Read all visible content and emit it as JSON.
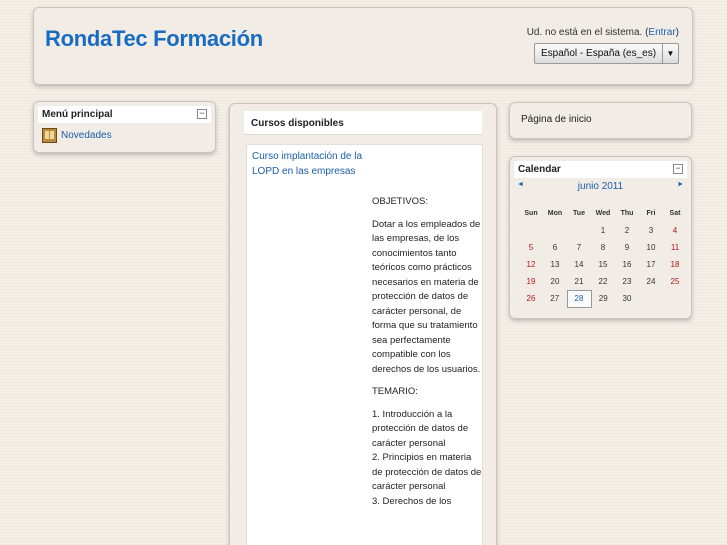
{
  "header": {
    "site_title": "RondaTec Formación",
    "login_text": "Ud. no está en el sistema.",
    "login_link": "Entrar",
    "language": "Español - España (es_es)",
    "colors": {
      "title": "#1a6bc2",
      "link": "#1a5ea8"
    }
  },
  "main_menu": {
    "title": "Menú principal",
    "collapse_symbol": "−",
    "items": [
      {
        "label": "Novedades",
        "icon": "news-icon"
      }
    ]
  },
  "courses": {
    "title": "Cursos disponibles",
    "course_name": "Curso implantación de la LOPD en las empresas",
    "desc": [
      "OBJETIVOS:",
      "Dotar a los empleados de las empresas, de los conocimientos tanto teóricos como prácticos necesarios en materia de protección de datos de carácter personal, de forma que su tratamiento sea perfectamente compatible con los derechos de los usuarios.",
      "TEMARIO:",
      "1. Introducción a la protección de datos de carácter personal\n2. Principios en materia de protección de datos de carácter personal\n3. Derechos de los"
    ]
  },
  "home_block": {
    "label": "Página de inicio"
  },
  "calendar": {
    "title": "Calendar",
    "collapse_symbol": "−",
    "prev": "◄",
    "next": "►",
    "month": "junio 2011",
    "weekdays": [
      "Sun",
      "Mon",
      "Tue",
      "Wed",
      "Thu",
      "Fri",
      "Sat"
    ],
    "weeks": [
      [
        "",
        "",
        "",
        "1",
        "2",
        "3",
        "4"
      ],
      [
        "5",
        "6",
        "7",
        "8",
        "9",
        "10",
        "11"
      ],
      [
        "12",
        "13",
        "14",
        "15",
        "16",
        "17",
        "18"
      ],
      [
        "19",
        "20",
        "21",
        "22",
        "23",
        "24",
        "25"
      ],
      [
        "26",
        "27",
        "28",
        "29",
        "30",
        "",
        ""
      ]
    ],
    "today": "28",
    "weekend_color": "#b3141d"
  }
}
